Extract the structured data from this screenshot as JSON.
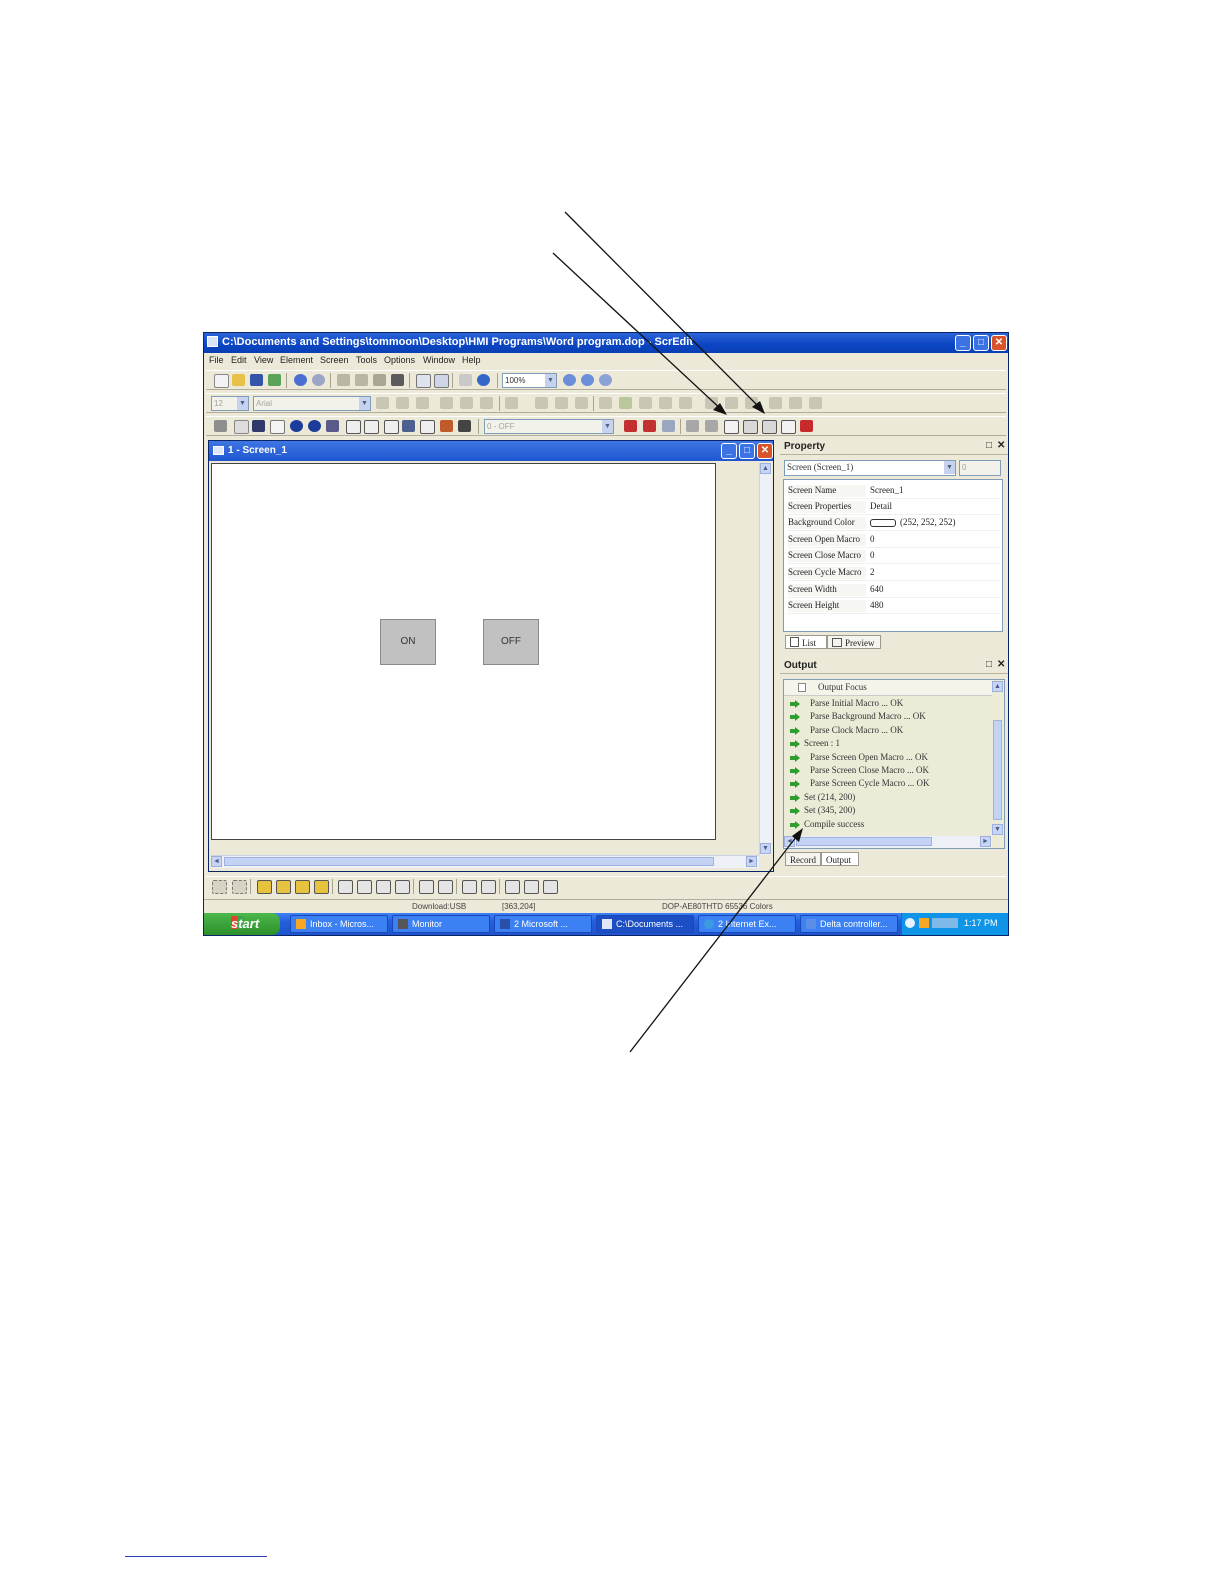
{
  "window": {
    "title": "C:\\Documents and Settings\\tommoon\\Desktop\\HMI Programs\\Word program.dop - ScrEdit",
    "controls": [
      "_",
      "□",
      "✕"
    ]
  },
  "menu": [
    "File",
    "Edit",
    "View",
    "Element",
    "Screen",
    "Tools",
    "Options",
    "Window",
    "Help"
  ],
  "toolbar": {
    "zoom": "100%",
    "font_size": "12",
    "font_name": "Arial",
    "state_select": "0 - OFF"
  },
  "screen_window": {
    "title": "1 - Screen_1",
    "buttons": [
      {
        "label": "ON"
      },
      {
        "label": "OFF"
      }
    ]
  },
  "property": {
    "header": "Property",
    "selector": "Screen (Screen_1)",
    "spin_value": "0",
    "rows": [
      {
        "key": "Screen Name",
        "value": "Screen_1"
      },
      {
        "key": "Screen Properties",
        "value": "Detail"
      },
      {
        "key": "Background Color",
        "value": "(252, 252, 252)"
      },
      {
        "key": "Screen Open Macro",
        "value": "0"
      },
      {
        "key": "Screen Close Macro",
        "value": "0"
      },
      {
        "key": "Screen Cycle Macro",
        "value": "2"
      },
      {
        "key": "Screen Width",
        "value": "640"
      },
      {
        "key": "Screen Height",
        "value": "480"
      }
    ],
    "tabs": [
      "List",
      "Preview"
    ]
  },
  "output": {
    "header": "Output",
    "focus_label": "Output Focus",
    "lines": [
      {
        "text": "Parse Initial Macro ... OK",
        "indent": true
      },
      {
        "text": "Parse Background Macro ... OK",
        "indent": true
      },
      {
        "text": "Parse Clock Macro ... OK",
        "indent": true
      },
      {
        "text": "Screen : 1",
        "indent": false
      },
      {
        "text": "Parse Screen Open Macro ... OK",
        "indent": true
      },
      {
        "text": "Parse Screen Close Macro ... OK",
        "indent": true
      },
      {
        "text": "Parse Screen Cycle Macro ... OK",
        "indent": true
      },
      {
        "text": "Set (214, 200)",
        "indent": false
      },
      {
        "text": "Set (345, 200)",
        "indent": false
      },
      {
        "text": "Compile success",
        "indent": false
      }
    ],
    "tabs": [
      "Record",
      "Output"
    ]
  },
  "status": {
    "download": "Download:USB",
    "coords": "[363,204]",
    "model": "DOP-AE80THTD 65536 Colors"
  },
  "taskbar": {
    "start": "start",
    "tasks": [
      "Inbox - Micros...",
      "Monitor",
      "2 Microsoft ...",
      "C:\\Documents ...",
      "2 Internet Ex...",
      "Delta controller..."
    ],
    "clock": "1:17 PM"
  },
  "colors": {
    "title_blue": "#0b45c2",
    "xp_face": "#ece9d8",
    "start_green": "#2d8f2b",
    "ok_arrow": "#2e9e2e"
  }
}
